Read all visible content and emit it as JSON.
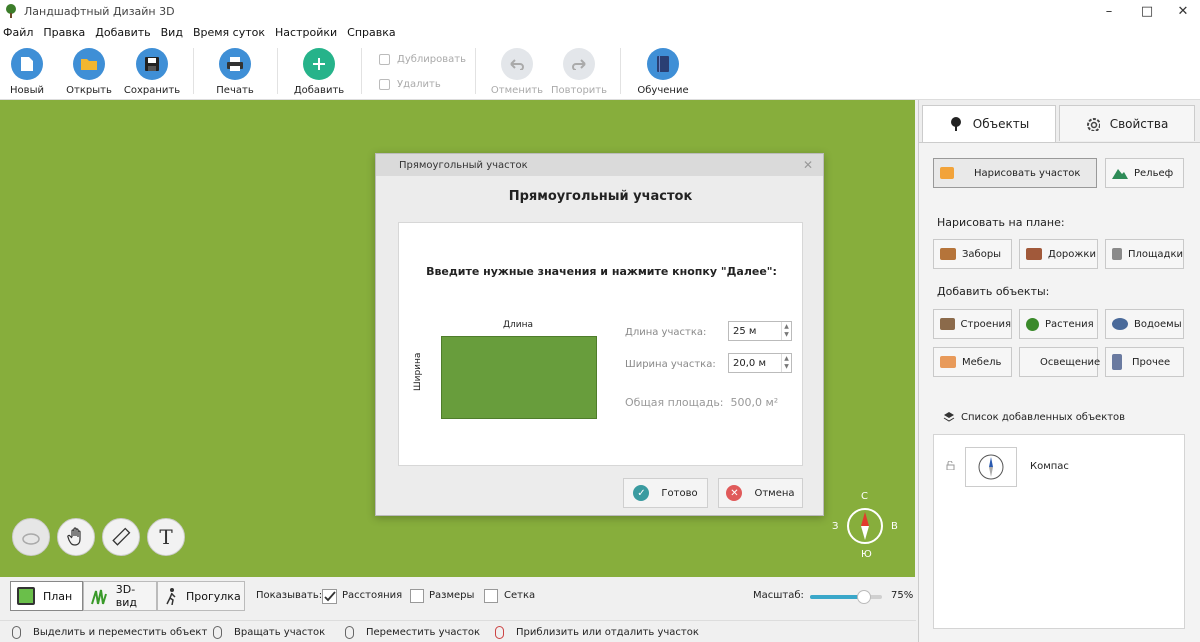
{
  "window": {
    "title": "Ландшафтный Дизайн 3D"
  },
  "menu": [
    "Файл",
    "Правка",
    "Добавить",
    "Вид",
    "Время суток",
    "Настройки",
    "Справка"
  ],
  "toolbar": {
    "new": "Новый",
    "open": "Открыть",
    "save": "Сохранить",
    "print": "Печать",
    "add": "Добавить",
    "duplicate": "Дублировать",
    "delete": "Удалить",
    "undo": "Отменить",
    "redo": "Повторить",
    "learn": "Обучение"
  },
  "dialog": {
    "window_title": "Прямоугольный участок",
    "heading": "Прямоугольный участок",
    "instruction": "Введите нужные значения и нажмите кнопку \"Далее\":",
    "length_dim_label": "Длина",
    "width_dim_label": "Ширина",
    "length_label": "Длина участка:",
    "length_value": "25 м",
    "width_label": "Ширина участка:",
    "width_value": "20,0 м",
    "area_label": "Общая площадь:",
    "area_value": "500,0 м²",
    "ok": "Готово",
    "cancel": "Отмена"
  },
  "compass": {
    "n": "С",
    "s": "Ю",
    "w": "З",
    "e": "В"
  },
  "canvas_tools": {
    "text_tool": "T"
  },
  "panel": {
    "tab_objects": "Объекты",
    "tab_properties": "Свойства",
    "draw_plot": "Нарисовать участок",
    "relief": "Рельеф",
    "draw_on_plan": "Нарисовать на плане:",
    "fences": "Заборы",
    "paths": "Дорожки",
    "areas": "Площадки",
    "add_objects": "Добавить объекты:",
    "buildings": "Строения",
    "plants": "Растения",
    "ponds": "Водоемы",
    "furniture": "Мебель",
    "lighting": "Освещение",
    "other": "Прочее",
    "list_title": "Список добавленных объектов",
    "list_items": [
      {
        "name": "Компас"
      }
    ]
  },
  "viewbar": {
    "plan": "План",
    "view3d": "3D-вид",
    "walk": "Прогулка",
    "show_label": "Показывать:",
    "distances": "Расстояния",
    "sizes": "Размеры",
    "grid": "Сетка",
    "scale_label": "Масштаб:",
    "scale_value": "75%",
    "scale_level": 0.75
  },
  "statusbar": {
    "select": "Выделить и переместить объект",
    "rotate": "Вращать участок",
    "move": "Переместить участок",
    "zoom": "Приблизить или отдалить участок"
  },
  "colors": {
    "canvas": "#87ae3c",
    "accent": "#3f8fd6",
    "ok": "#3a9ba0",
    "cancel": "#e05a5a",
    "plot": "#689d3c"
  }
}
